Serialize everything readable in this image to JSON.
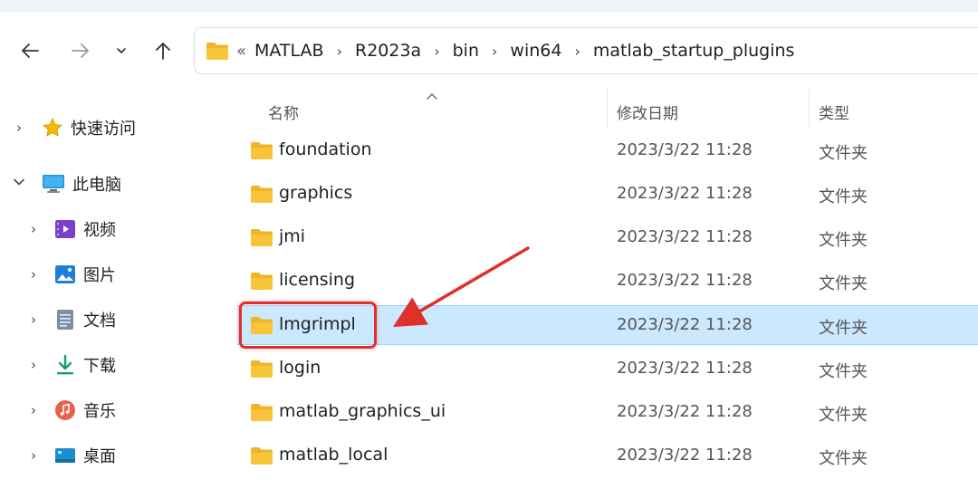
{
  "nav": {
    "back_icon": "arrow-left-icon",
    "forward_icon": "arrow-right-icon",
    "recent_icon": "chevron-down-icon",
    "up_icon": "arrow-up-icon"
  },
  "address_bar": {
    "overflow_marker": "«",
    "segments": [
      "MATLAB",
      "R2023a",
      "bin",
      "win64",
      "matlab_startup_plugins"
    ]
  },
  "sidebar": {
    "items": [
      {
        "label": "快速访问",
        "icon": "star-icon"
      },
      {
        "label": "此电脑",
        "icon": "computer-icon"
      },
      {
        "label": "视频",
        "icon": "video-icon"
      },
      {
        "label": "图片",
        "icon": "picture-icon"
      },
      {
        "label": "文档",
        "icon": "document-icon"
      },
      {
        "label": "下载",
        "icon": "download-icon"
      },
      {
        "label": "音乐",
        "icon": "music-icon"
      },
      {
        "label": "桌面",
        "icon": "desktop-icon"
      }
    ]
  },
  "columns": {
    "name": "名称",
    "date": "修改日期",
    "type": "类型",
    "sort_icon": "sort-up-icon"
  },
  "files": [
    {
      "name": "foundation",
      "date": "2023/3/22 11:28",
      "type": "文件夹"
    },
    {
      "name": "graphics",
      "date": "2023/3/22 11:28",
      "type": "文件夹"
    },
    {
      "name": "jmi",
      "date": "2023/3/22 11:28",
      "type": "文件夹"
    },
    {
      "name": "licensing",
      "date": "2023/3/22 11:28",
      "type": "文件夹"
    },
    {
      "name": "lmgrimpl",
      "date": "2023/3/22 11:28",
      "type": "文件夹"
    },
    {
      "name": "login",
      "date": "2023/3/22 11:28",
      "type": "文件夹"
    },
    {
      "name": "matlab_graphics_ui",
      "date": "2023/3/22 11:28",
      "type": "文件夹"
    },
    {
      "name": "matlab_local",
      "date": "2023/3/22 11:28",
      "type": "文件夹"
    }
  ],
  "selected_file": "lmgrimpl",
  "colors": {
    "selection": "#cce8ff",
    "annotation": "#e0302a",
    "folder": "#f8c43a"
  }
}
